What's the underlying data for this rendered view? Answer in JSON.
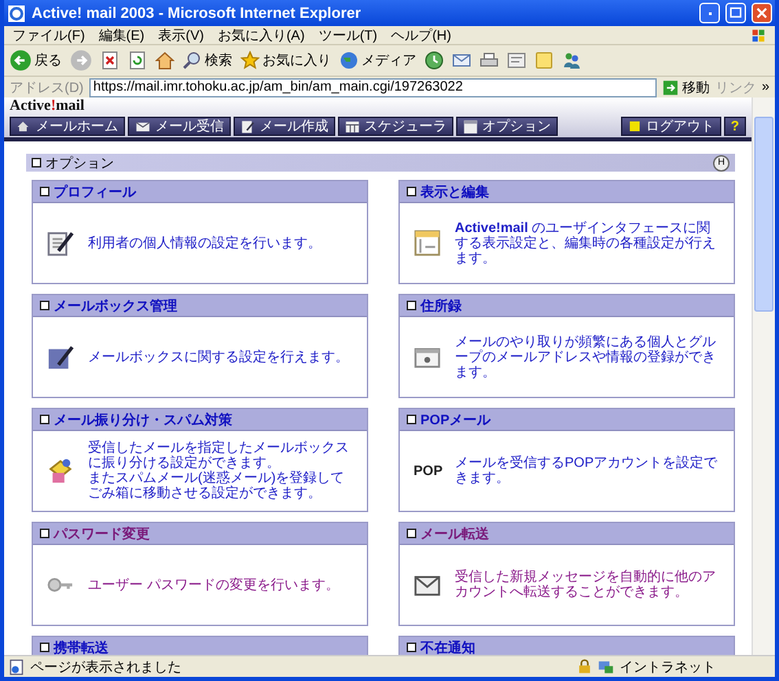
{
  "window": {
    "title": "Active! mail 2003 - Microsoft Internet Explorer"
  },
  "menu": [
    "ファイル(F)",
    "編集(E)",
    "表示(V)",
    "お気に入り(A)",
    "ツール(T)",
    "ヘルプ(H)"
  ],
  "toolbar": [
    {
      "kind": "back",
      "label": "戻る"
    },
    {
      "kind": "forward"
    },
    {
      "kind": "stop"
    },
    {
      "kind": "refresh"
    },
    {
      "kind": "home"
    },
    {
      "kind": "search",
      "label": "検索"
    },
    {
      "kind": "favorites",
      "label": "お気に入り"
    },
    {
      "kind": "media",
      "label": "メディア"
    },
    {
      "kind": "history"
    },
    {
      "kind": "mail"
    },
    {
      "kind": "print"
    },
    {
      "kind": "edit"
    },
    {
      "kind": "notes"
    },
    {
      "kind": "messenger"
    }
  ],
  "address": {
    "label": "アドレス(D)",
    "url": "https://mail.imr.tohoku.ac.jp/am_bin/am_main.cgi/197263022",
    "go": "移動",
    "links": "リンク",
    "more": "»"
  },
  "app": {
    "logo": [
      {
        "text": "Active",
        "accent": false
      },
      {
        "text": "!",
        "accent": true
      },
      {
        "text": "mail",
        "accent": false
      }
    ],
    "nav": [
      {
        "kind": "home",
        "label": "メールホーム"
      },
      {
        "kind": "inbox",
        "label": "メール受信"
      },
      {
        "kind": "compose",
        "label": "メール作成"
      },
      {
        "kind": "schedule",
        "label": "スケジューラ"
      },
      {
        "kind": "options",
        "label": "オプション"
      }
    ],
    "logout": "ログアウト",
    "help": "?"
  },
  "section": {
    "title": "オプション",
    "help": "H"
  },
  "cards": [
    {
      "kind": "profile",
      "title": "プロフィール",
      "text": "利用者の個人情報の設定を行います。",
      "visited": false
    },
    {
      "kind": "display",
      "title": "表示と編集",
      "text": "**Active!mail** のユーザインタフェースに関する表示設定と、編集時の各種設定が行えます。",
      "visited": false
    },
    {
      "kind": "mailbox",
      "title": "メールボックス管理",
      "text": "メールボックスに関する設定を行えます。",
      "visited": false
    },
    {
      "kind": "address",
      "title": "住所録",
      "text": "メールのやり取りが頻繁にある個人とグループのメールアドレスや情報の登録ができます。",
      "visited": false
    },
    {
      "kind": "filter",
      "title": "メール振り分け・スパム対策",
      "text": "受信したメールを指定したメールボックスに振り分ける設定ができます。",
      "text2": "またスパムメール(迷惑メール)を登録してごみ箱に移動させる設定ができます。",
      "visited": false
    },
    {
      "kind": "pop",
      "title": "POPメール",
      "text": "メールを受信するPOPアカウントを設定できます。",
      "icon_label": "POP",
      "visited": false
    },
    {
      "kind": "password",
      "title": "パスワード変更",
      "text": "ユーザー パスワードの変更を行います。",
      "visited": true
    },
    {
      "kind": "forward",
      "title": "メール転送",
      "text": "受信した新規メッセージを自動的に他のアカウントへ転送することができます。",
      "visited": true
    },
    {
      "kind": "mobile",
      "title": "携帯転送",
      "visited": false
    },
    {
      "kind": "absence",
      "title": "不在通知",
      "visited": false
    }
  ],
  "status": {
    "text": "ページが表示されました",
    "zone": "イントラネット"
  }
}
